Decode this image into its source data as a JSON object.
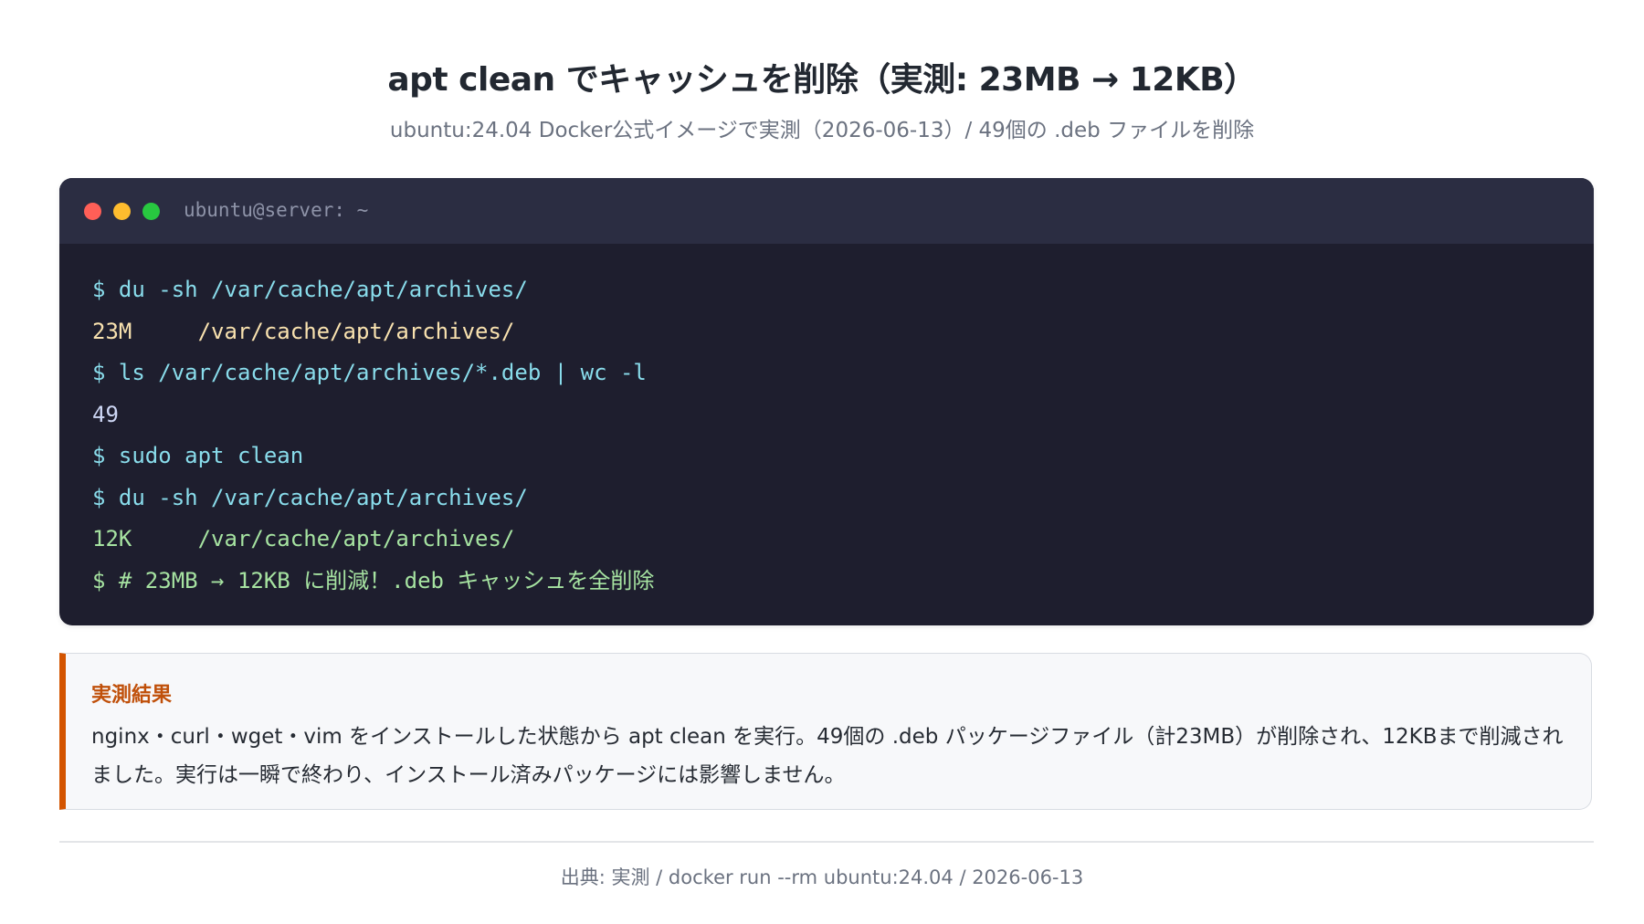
{
  "header": {
    "title": "apt clean でキャッシュを削除（実測: 23MB → 12KB）",
    "subtitle": "ubuntu:24.04 Docker公式イメージで実測（2026-06-13）/ 49個の .deb ファイルを削除"
  },
  "terminal": {
    "title": "ubuntu@server: ~",
    "lines": [
      {
        "text": "$ du -sh /var/cache/apt/archives/"
      },
      {
        "text": "23M     /var/cache/apt/archives/"
      },
      {
        "text": "$ ls /var/cache/apt/archives/*.deb | wc -l"
      },
      {
        "text": "49"
      },
      {
        "text": "$ sudo apt clean"
      },
      {
        "text": "$ du -sh /var/cache/apt/archives/"
      },
      {
        "text": "12K     /var/cache/apt/archives/"
      },
      {
        "text": "$ # 23MB → 12KB に削減！.deb キャッシュを全削除"
      }
    ],
    "colors": {
      "background": "#1e1e2e",
      "titlebar": "#2b2d42",
      "command": "#89dceb",
      "output_highlight": "#f9e2af",
      "output_plain": "#cdd6f4",
      "output_green": "#a6e3a1"
    }
  },
  "callout": {
    "heading": "実測結果",
    "body": "nginx・curl・wget・vim をインストールした状態から apt clean を実行。49個の .deb パッケージファイル（計23MB）が削除され、12KBまで削減されました。実行は一瞬で終わり、インストール済みパッケージには影響しません。",
    "accent_color": "#d35400"
  },
  "footer": {
    "source": "出典: 実測 / docker run --rm ubuntu:24.04 / 2026-06-13"
  }
}
